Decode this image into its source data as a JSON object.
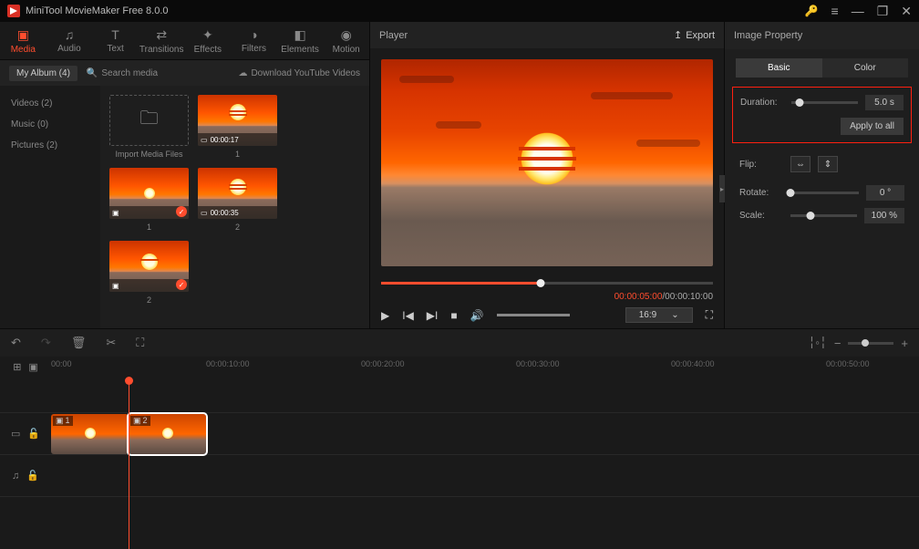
{
  "titlebar": {
    "title": "MiniTool MovieMaker Free 8.0.0"
  },
  "tabs": {
    "media": "Media",
    "audio": "Audio",
    "text": "Text",
    "transitions": "Transitions",
    "effects": "Effects",
    "filters": "Filters",
    "elements": "Elements",
    "motion": "Motion"
  },
  "media": {
    "album": "My Album (4)",
    "search": "Search media",
    "download": "Download YouTube Videos",
    "side": {
      "videos": "Videos (2)",
      "music": "Music (0)",
      "pictures": "Pictures (2)"
    },
    "import_label": "Import Media Files",
    "thumb1_dur": "00:00:17",
    "thumb1_label": "1",
    "thumb2_label": "1",
    "thumb3_dur": "00:00:35",
    "thumb3_label": "2",
    "thumb4_label": "2"
  },
  "player": {
    "title": "Player",
    "export": "Export",
    "current": "00:00:05:00",
    "sep": " / ",
    "total": "00:00:10:00",
    "ratio": "16:9"
  },
  "props": {
    "title": "Image Property",
    "tab_basic": "Basic",
    "tab_color": "Color",
    "duration_label": "Duration:",
    "duration_val": "5.0 s",
    "apply": "Apply to all",
    "flip_label": "Flip:",
    "rotate_label": "Rotate:",
    "rotate_val": "0 °",
    "scale_label": "Scale:",
    "scale_val": "100 %"
  },
  "ruler": {
    "t0": "00:00",
    "t1": "00:00:10:00",
    "t2": "00:00:20:00",
    "t3": "00:00:30:00",
    "t4": "00:00:40:00",
    "t5": "00:00:50:00"
  },
  "clips": {
    "c1": "1",
    "c2": "2"
  }
}
